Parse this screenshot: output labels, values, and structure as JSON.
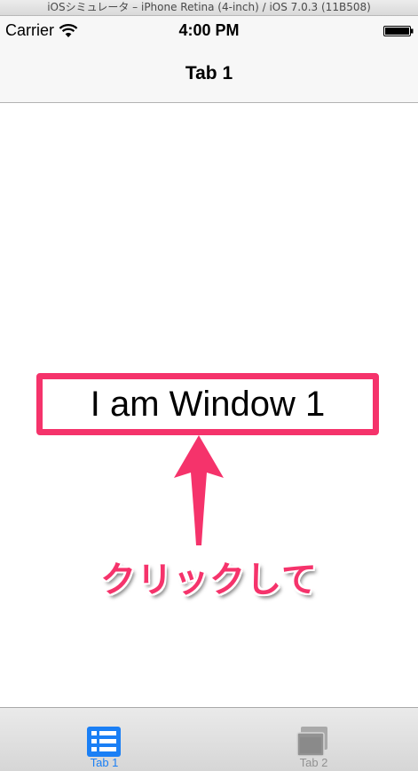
{
  "simulator": {
    "title": "iOSシミュレータ – iPhone Retina (4-inch) / iOS 7.0.3 (11B508)"
  },
  "status_bar": {
    "carrier": "Carrier",
    "time": "4:00 PM",
    "wifi_icon": "wifi-icon",
    "battery_icon": "battery-icon"
  },
  "nav_bar": {
    "title": "Tab 1"
  },
  "content": {
    "window_label": "I am Window 1",
    "callout_text": "クリックして",
    "callout_arrow_icon": "up-arrow-icon",
    "highlight_color": "#f5336b"
  },
  "tab_bar": {
    "tabs": [
      {
        "label": "Tab 1",
        "icon": "list-icon",
        "selected": true,
        "color": "#1a7ff5"
      },
      {
        "label": "Tab 2",
        "icon": "windows-icon",
        "selected": false,
        "color": "#929292"
      }
    ]
  }
}
